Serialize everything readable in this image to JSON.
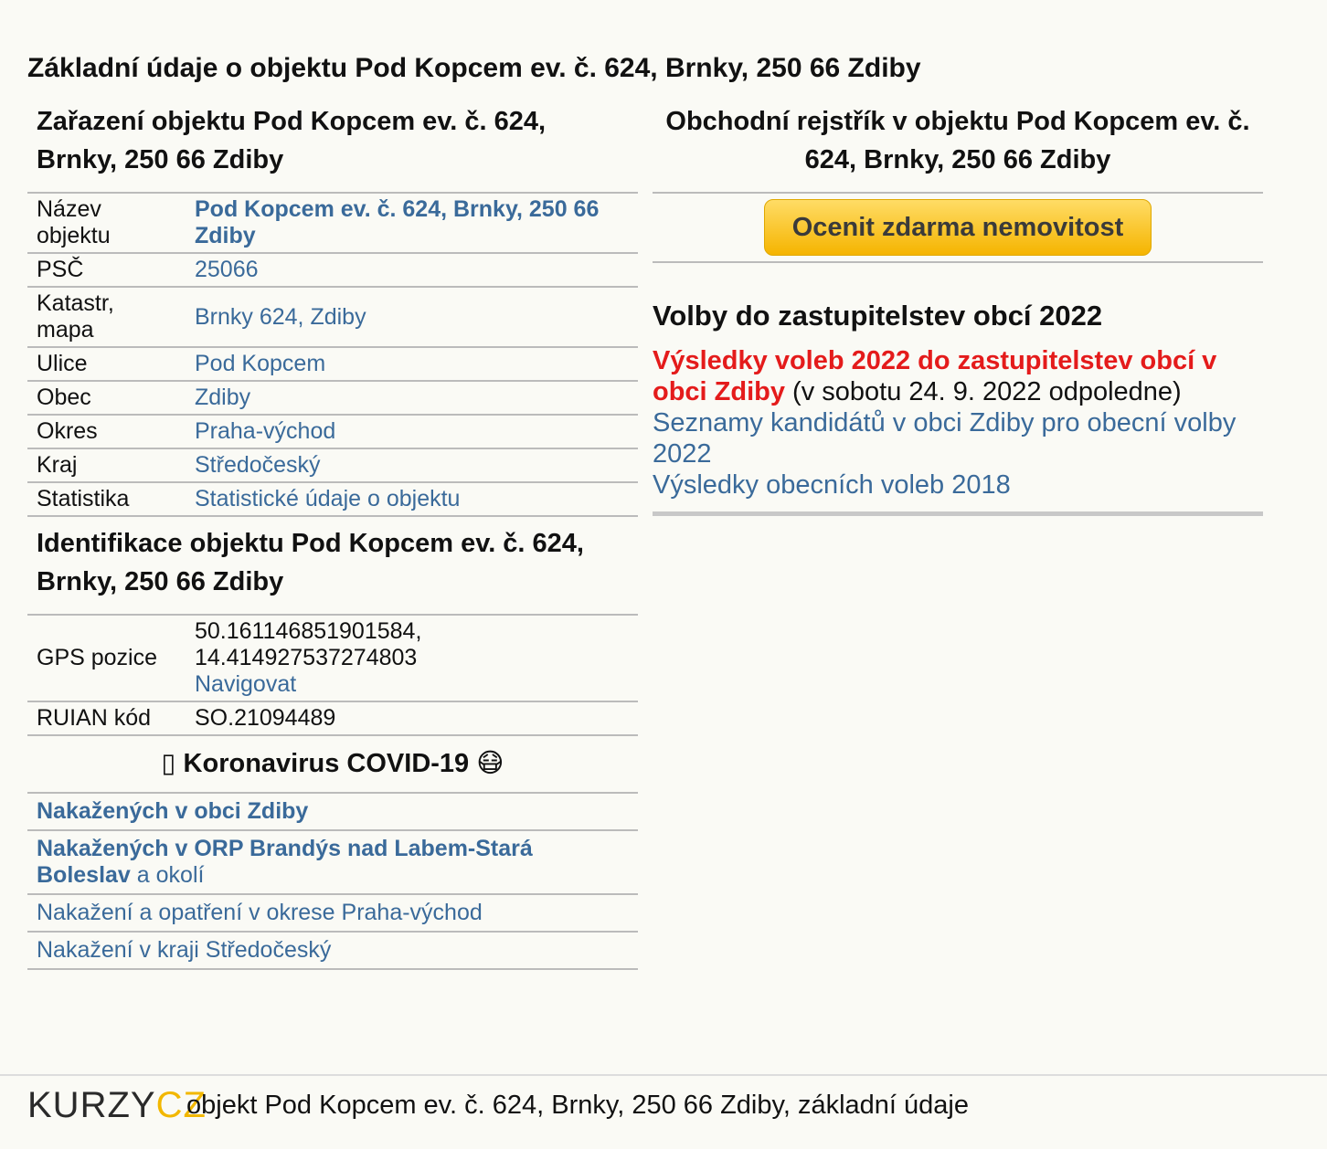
{
  "page_title": "Základní údaje o objektu Pod Kopcem ev. č. 624, Brnky, 250 66 Zdiby",
  "classification": {
    "heading": "Zařazení objektu Pod Kopcem ev. č. 624, Brnky, 250 66 Zdiby",
    "rows": [
      {
        "label": "Název objektu",
        "value": "Pod Kopcem ev. č. 624, Brnky, 250 66 Zdiby"
      },
      {
        "label": "PSČ",
        "value": "25066"
      },
      {
        "label": "Katastr, mapa",
        "value": "Brnky 624, Zdiby"
      },
      {
        "label": "Ulice",
        "value": "Pod Kopcem"
      },
      {
        "label": "Obec",
        "value": "Zdiby"
      },
      {
        "label": "Okres",
        "value": "Praha-východ"
      },
      {
        "label": "Kraj",
        "value": "Středočeský"
      },
      {
        "label": "Statistika",
        "value": "Statistické údaje o objektu"
      }
    ]
  },
  "identification": {
    "heading": "Identifikace objektu Pod Kopcem ev. č. 624, Brnky, 250 66 Zdiby",
    "gps_label": "GPS pozice",
    "gps_lat": "50.161146851901584,",
    "gps_lon": "14.414927537274803",
    "navigate": "Navigovat",
    "ruian_label": "RUIAN kód",
    "ruian_value": "SO.21094489"
  },
  "covid": {
    "heading": "Koronavirus COVID-19",
    "prefix_glyph": "▯",
    "suffix_glyph": "😷",
    "links": [
      {
        "bold": "Nakažených v obci Zdiby",
        "rest": ""
      },
      {
        "bold": "Nakažených v ORP Brandýs nad Labem-Stará Boleslav",
        "rest": " a okolí"
      },
      {
        "bold": "",
        "rest": "Nakažení a opatření v okrese Praha-východ"
      },
      {
        "bold": "",
        "rest": "Nakažení v kraji Středočeský"
      }
    ]
  },
  "register": {
    "heading": "Obchodní rejstřík v objektu Pod Kopcem ev. č. 624, Brnky, 250 66 Zdiby",
    "button": "Ocenit zdarma nemovitost"
  },
  "elections": {
    "heading": "Volby do zastupitelstev obcí 2022",
    "results_link": "Výsledky voleb 2022 do zastupitelstev obcí v obci Zdiby",
    "results_note": " (v sobotu 24. 9. 2022 odpoledne)",
    "candidates_link": "Seznamy kandidátů v obci Zdiby pro obecní volby 2022",
    "results_2018": "Výsledky obecních voleb 2018"
  },
  "footer": {
    "logo_main": "KURZY",
    "logo_accent": "CZ",
    "text": "objekt Pod Kopcem ev. č. 624, Brnky, 250 66 Zdiby, základní údaje"
  },
  "colors": {
    "link": "#3a6a9a",
    "accent_red": "#e41b1b",
    "button": "#f5b400",
    "background": "#fafaf5"
  }
}
